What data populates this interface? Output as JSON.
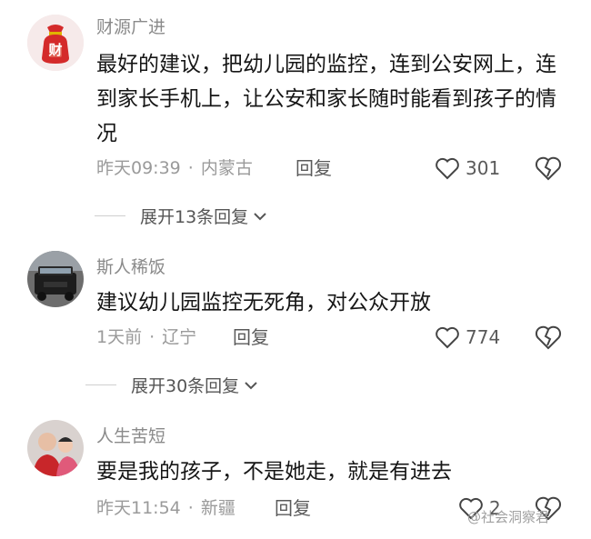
{
  "comments": [
    {
      "username": "财源广进",
      "text": "最好的建议，把幼儿园的监控，连到公安网上，连到家长手机上，让公安和家长随时能看到孩子的情况",
      "time": "昨天09:39",
      "location": "内蒙古",
      "reply_label": "回复",
      "likes": "301",
      "expand_label": "展开13条回复",
      "avatar_text": "财"
    },
    {
      "username": "斯人稀饭",
      "text": "建议幼儿园监控无死角，对公众开放",
      "time": "1天前",
      "location": "辽宁",
      "reply_label": "回复",
      "likes": "774",
      "expand_label": "展开30条回复"
    },
    {
      "username": "人生苦短",
      "text": "要是我的孩子，不是她走，就是有进去",
      "time": "昨天11:54",
      "location": "新疆",
      "reply_label": "回复",
      "likes": "2"
    }
  ],
  "separator": "·",
  "watermark": "@社会洞察君",
  "colors": {
    "username": "#8a8a8a",
    "text": "#161616",
    "meta": "#9a9a9a"
  }
}
